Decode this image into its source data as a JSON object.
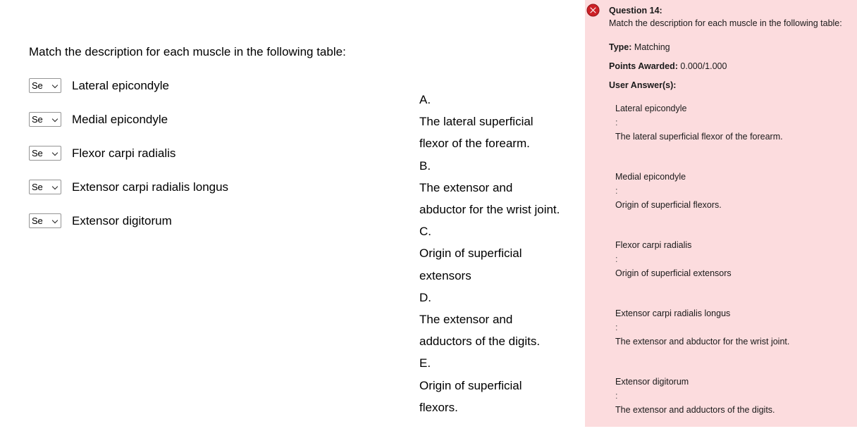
{
  "question": {
    "prompt": "Match the description for each muscle in the following table:",
    "items": [
      {
        "select_value": "Se",
        "select_placeholder": "Select",
        "label": "Lateral epicondyle"
      },
      {
        "select_value": "Se",
        "select_placeholder": "Select",
        "label": "Medial epicondyle"
      },
      {
        "select_value": "Se",
        "select_placeholder": "Select",
        "label": "Flexor carpi radialis"
      },
      {
        "select_value": "Se",
        "select_placeholder": "Select",
        "label": "Extensor carpi radialis longus"
      },
      {
        "select_value": "Se",
        "select_placeholder": "Select",
        "label": "Extensor digitorum"
      }
    ],
    "options": [
      {
        "letter": "A.",
        "text": "The lateral superficial flexor of the forearm."
      },
      {
        "letter": "B.",
        "text": "The extensor and abductor for the wrist joint."
      },
      {
        "letter": "C.",
        "text": "Origin of superficial extensors"
      },
      {
        "letter": "D.",
        "text": "The extensor and adductors of the digits."
      },
      {
        "letter": "E.",
        "text": "Origin of superficial flexors."
      }
    ]
  },
  "feedback": {
    "icon": "error-circle-x-icon",
    "accent_color": "#cc2026",
    "background_color": "#fcdcde",
    "question_label": "Question 14:",
    "question_text": "Match the description for each muscle in the following table:",
    "type_label": "Type:",
    "type_value": "Matching",
    "points_label": "Points Awarded:",
    "points_value": "0.000/1.000",
    "user_answers_label": "User Answer(s):",
    "answers": [
      {
        "term": "Lateral epicondyle",
        "separator": ":",
        "description": "The lateral superficial flexor of the forearm."
      },
      {
        "term": "Medial epicondyle",
        "separator": ":",
        "description": "Origin of superficial flexors."
      },
      {
        "term": "Flexor carpi radialis",
        "separator": ":",
        "description": "Origin of superficial extensors"
      },
      {
        "term": "Extensor carpi radialis longus",
        "separator": ":",
        "description": "The extensor and abductor for the wrist joint."
      },
      {
        "term": "Extensor digitorum",
        "separator": ":",
        "description": "The extensor and adductors of the digits."
      }
    ]
  }
}
